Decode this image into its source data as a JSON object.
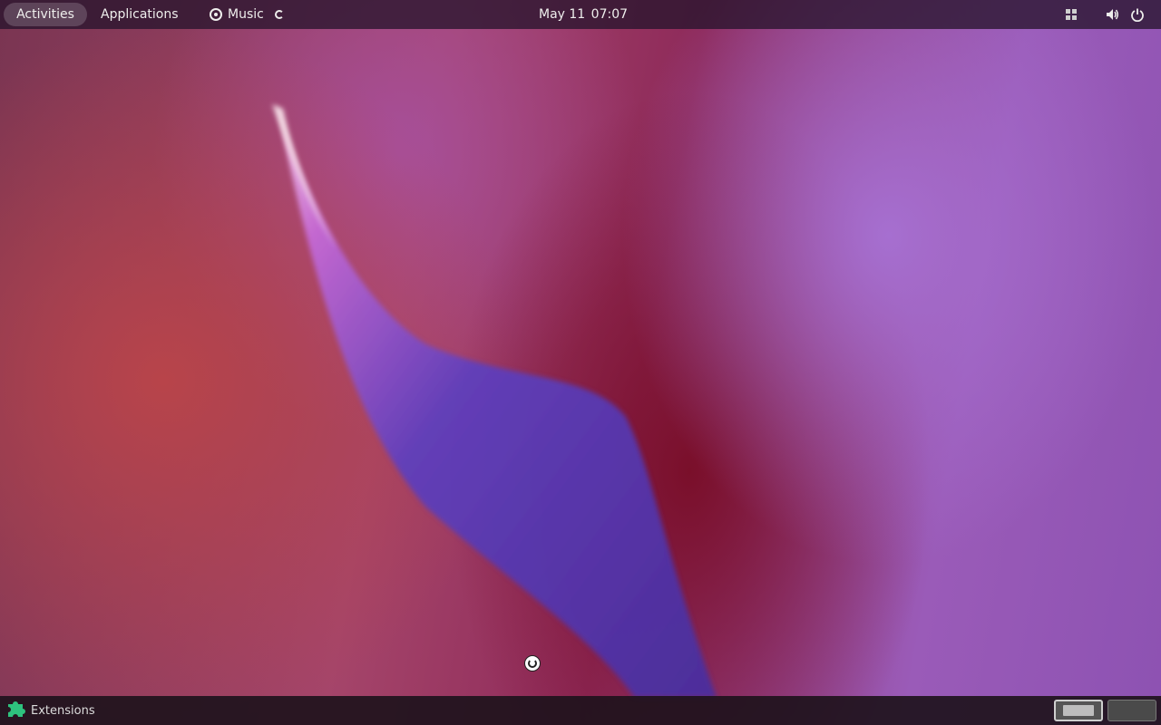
{
  "topbar": {
    "activities_label": "Activities",
    "applications_label": "Applications",
    "app_menu_label": "Music",
    "clock": {
      "date": "May 11",
      "time": "07:07"
    },
    "tray_icons": [
      "workspace-grid-icon",
      "volume-icon",
      "power-icon"
    ]
  },
  "bottombar": {
    "extensions_label": "Extensions",
    "workspaces": [
      {
        "label": "",
        "active": true
      },
      {
        "label": "",
        "active": false
      }
    ]
  },
  "colors": {
    "panel": "#28142d",
    "accent_extensions": "#2ec27e",
    "panel_text": "#eeeeec"
  }
}
